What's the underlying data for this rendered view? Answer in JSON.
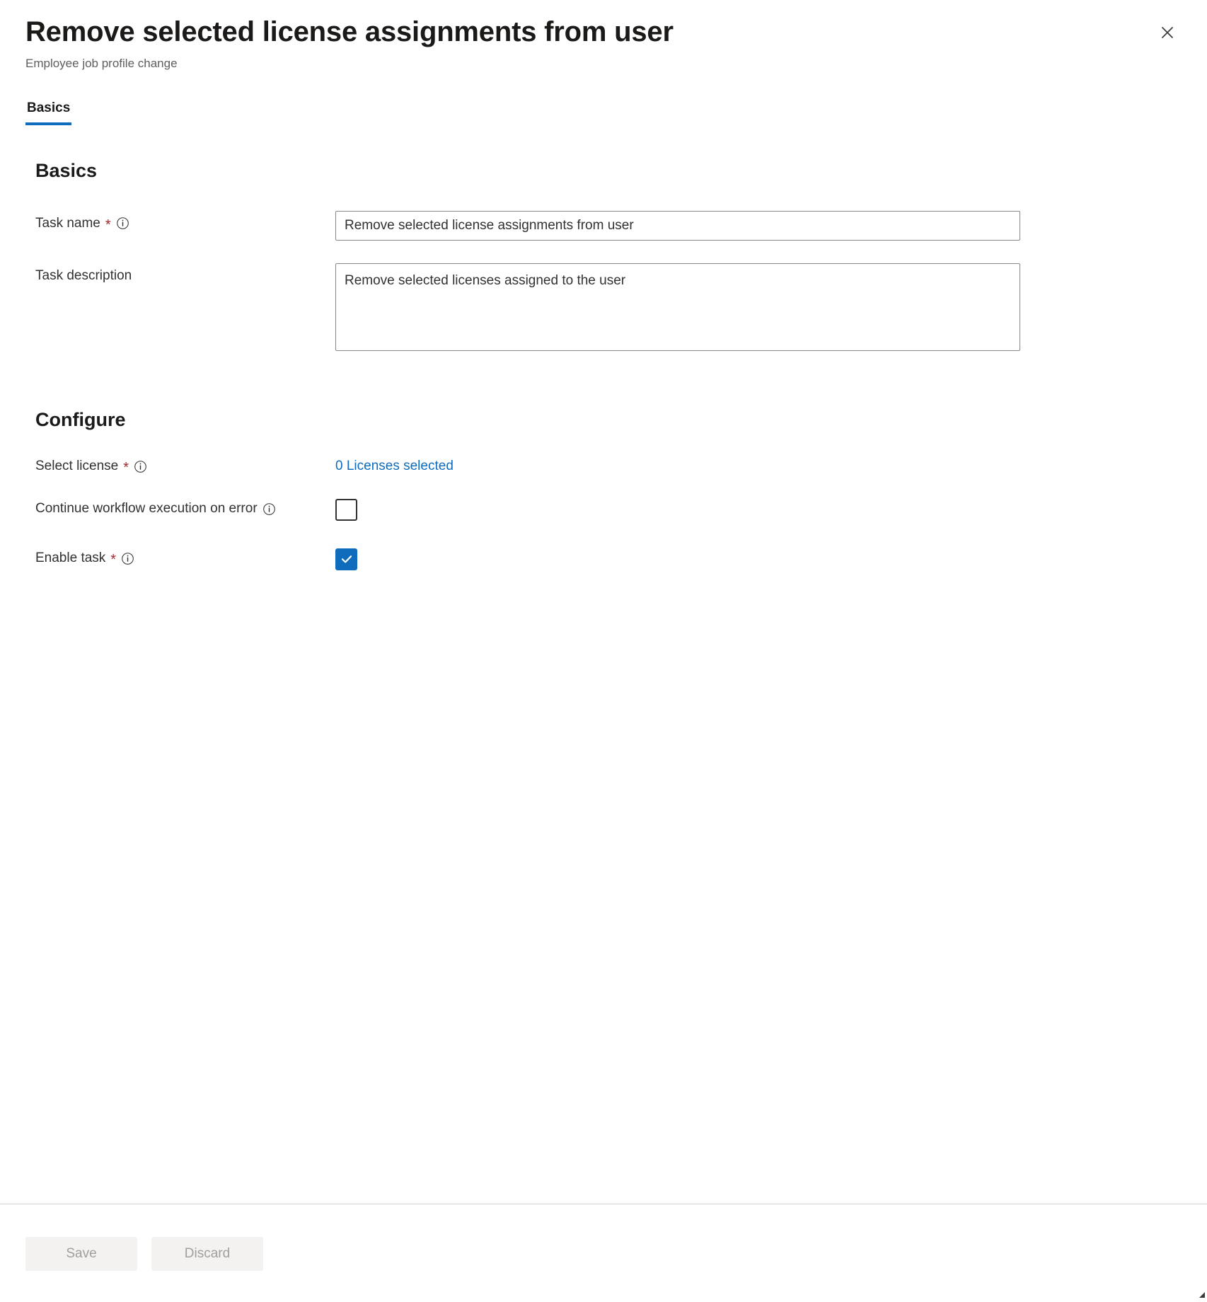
{
  "header": {
    "title": "Remove selected license assignments from user",
    "subtitle": "Employee job profile change",
    "close_label": "Close",
    "close_icon": "close-icon"
  },
  "tabs": [
    {
      "label": "Basics",
      "selected": true
    }
  ],
  "sections": {
    "basics": {
      "heading": "Basics",
      "task_name": {
        "label": "Task name",
        "required_marker": "*",
        "info_icon": "info-icon",
        "value": "Remove selected license assignments from user",
        "placeholder": ""
      },
      "task_description": {
        "label": "Task description",
        "value": "Remove selected licenses assigned to the user",
        "placeholder": ""
      }
    },
    "configure": {
      "heading": "Configure",
      "select_license": {
        "label": "Select license",
        "required_marker": "*",
        "info_icon": "info-icon",
        "link_text": "0 Licenses selected",
        "link_color": "#0f6cbd"
      },
      "continue_on_error": {
        "label": "Continue workflow execution on error",
        "info_icon": "info-icon",
        "checked": false
      },
      "enable_task": {
        "label": "Enable task",
        "required_marker": "*",
        "info_icon": "info-icon",
        "checked": true
      }
    }
  },
  "footer": {
    "save_label": "Save",
    "discard_label": "Discard",
    "save_enabled": false,
    "discard_enabled": false
  },
  "colors": {
    "accent": "#0f6cbd",
    "required": "#a4262c",
    "text": "#323130",
    "muted": "#605e5c",
    "border": "#8a8886",
    "disabled_bg": "#f3f2f1",
    "disabled_text": "#a19f9d"
  }
}
